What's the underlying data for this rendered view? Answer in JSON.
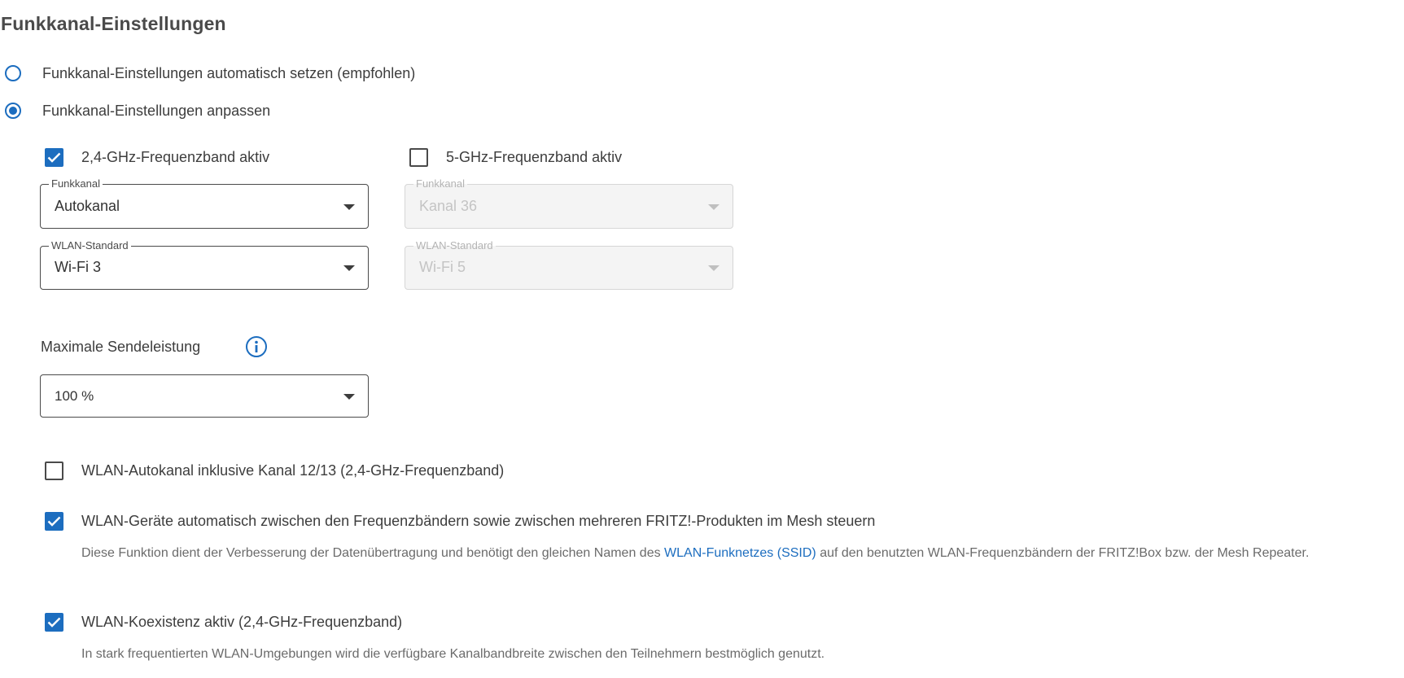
{
  "section": {
    "title": "Funkkanal-Einstellungen"
  },
  "mode": {
    "auto_label": "Funkkanal-Einstellungen automatisch setzen (empfohlen)",
    "custom_label": "Funkkanal-Einstellungen anpassen",
    "selected": "custom"
  },
  "band24": {
    "label": "2,4-GHz-Frequenzband aktiv",
    "checked": true,
    "channel_legend": "Funkkanal",
    "channel_value": "Autokanal",
    "standard_legend": "WLAN-Standard",
    "standard_value": "Wi-Fi 3"
  },
  "band5": {
    "label": "5-GHz-Frequenzband aktiv",
    "checked": false,
    "channel_legend": "Funkkanal",
    "channel_value": "Kanal 36",
    "standard_legend": "WLAN-Standard",
    "standard_value": "Wi-Fi 5"
  },
  "power": {
    "label": "Maximale Sendeleistung",
    "info_icon": "info-icon",
    "value": "100 %"
  },
  "options": {
    "autochannel_label": "WLAN-Autokanal inklusive Kanal 12/13 (2,4-GHz-Frequenzband)",
    "autochannel_checked": false,
    "steering_label": "WLAN-Geräte automatisch zwischen den Frequenzbändern sowie zwischen mehreren FRITZ!-Produkten im Mesh steuern",
    "steering_checked": true,
    "steering_desc_before": "Diese Funktion dient der Verbesserung der Datenübertragung und benötigt den gleichen Namen des ",
    "steering_desc_link": "WLAN-Funknetzes (SSID)",
    "steering_desc_after": " auf den benutzten WLAN-Frequenzbändern der FRITZ!Box bzw. der Mesh Repeater.",
    "coexistence_label": "WLAN-Koexistenz aktiv (2,4-GHz-Frequenzband)",
    "coexistence_checked": true,
    "coexistence_desc": "In stark frequentierten WLAN-Umgebungen wird die verfügbare Kanalbandbreite zwischen den Teilnehmern bestmöglich genutzt."
  },
  "colors": {
    "accent": "#1c6dbf",
    "text": "#3d3d3d",
    "muted": "#6b6b6b",
    "disabled": "#c4c4c4"
  }
}
